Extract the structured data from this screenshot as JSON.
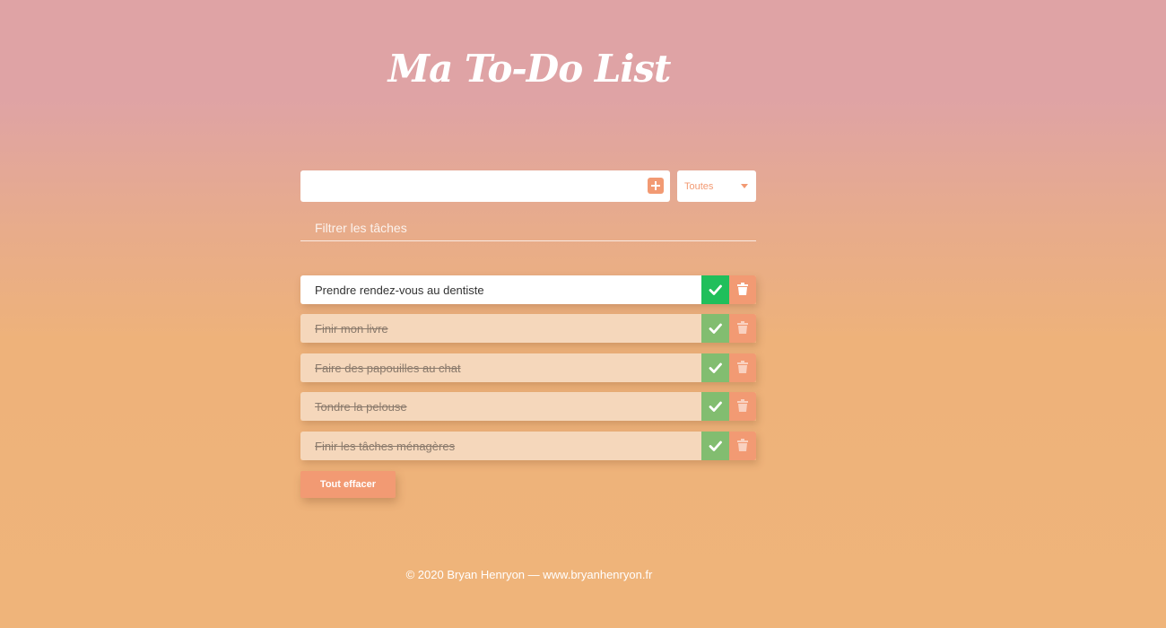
{
  "app": {
    "title": "Ma To-Do List"
  },
  "add": {
    "placeholder": "",
    "value": ""
  },
  "status_filter": {
    "selected": "Toutes"
  },
  "search": {
    "placeholder": "Filtrer les tâches"
  },
  "tasks": [
    {
      "text": "Prendre rendez-vous au dentiste",
      "done": false
    },
    {
      "text": "Finir mon livre",
      "done": true
    },
    {
      "text": "Faire des papouilles au chat",
      "done": true
    },
    {
      "text": "Tondre la pelouse",
      "done": true
    },
    {
      "text": "Finir les tâches ménagères",
      "done": true
    }
  ],
  "clear_button": {
    "label": "Tout effacer"
  },
  "footer": {
    "text": "© 2020 Bryan Henryon — www.bryanhenryon.fr"
  },
  "icons": {
    "add": "plus-square-icon",
    "select": "caret-down-icon",
    "complete": "check-icon",
    "delete": "trash-icon"
  },
  "colors": {
    "accent": "#f29a73",
    "done_check": "#82bd70",
    "active_check": "#20bf5b",
    "done_row": "#f5d7bb"
  }
}
